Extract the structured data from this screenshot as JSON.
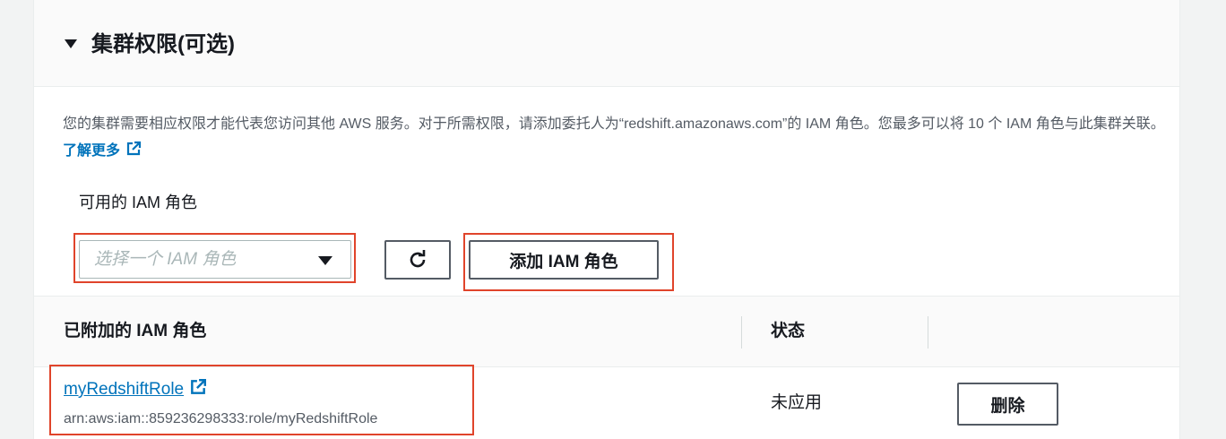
{
  "section": {
    "title": "集群权限(可选)",
    "description": "您的集群需要相应权限才能代表您访问其他 AWS 服务。对于所需权限，请添加委托人为“redshift.amazonaws.com”的 IAM 角色。您最多可以将 10 个 IAM 角色与此集群关联。",
    "learn_more": "了解更多"
  },
  "available_roles": {
    "label": "可用的 IAM 角色",
    "placeholder": "选择一个 IAM 角色",
    "add_button": "添加 IAM 角色"
  },
  "table": {
    "headers": [
      "已附加的 IAM 角色",
      "状态"
    ],
    "rows": [
      {
        "role_name": "myRedshiftRole",
        "arn": "arn:aws:iam::859236298333:role/myRedshiftRole",
        "status": "未应用",
        "action": "删除"
      }
    ]
  },
  "icons": {
    "caret": "caret-down-icon",
    "external": "external-link-icon",
    "refresh": "refresh-icon",
    "select_arrow": "dropdown-arrow-icon"
  },
  "colors": {
    "link": "#0073bb",
    "highlight": "#e0442b",
    "header_bg": "#fafafa",
    "page_bg": "#f2f3f3"
  }
}
